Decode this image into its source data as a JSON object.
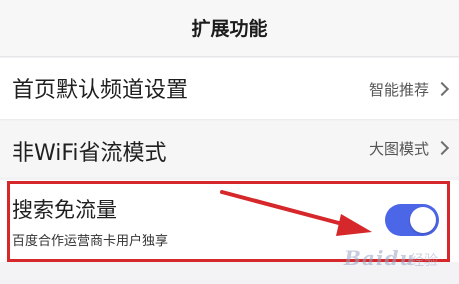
{
  "header": {
    "title": "扩展功能"
  },
  "settings": [
    {
      "label": "首页默认频道设置",
      "value": "智能推荐"
    },
    {
      "label": "非WiFi省流模式",
      "value": "大图模式"
    },
    {
      "label": "搜索免流量",
      "subtitle": "百度合作运营商卡用户独享",
      "enabled": true
    }
  ],
  "annotation": {
    "color": "#d6282b"
  },
  "toggle_color": "#4c66e8",
  "watermark": {
    "text": "Baidu",
    "sub": "经验"
  }
}
